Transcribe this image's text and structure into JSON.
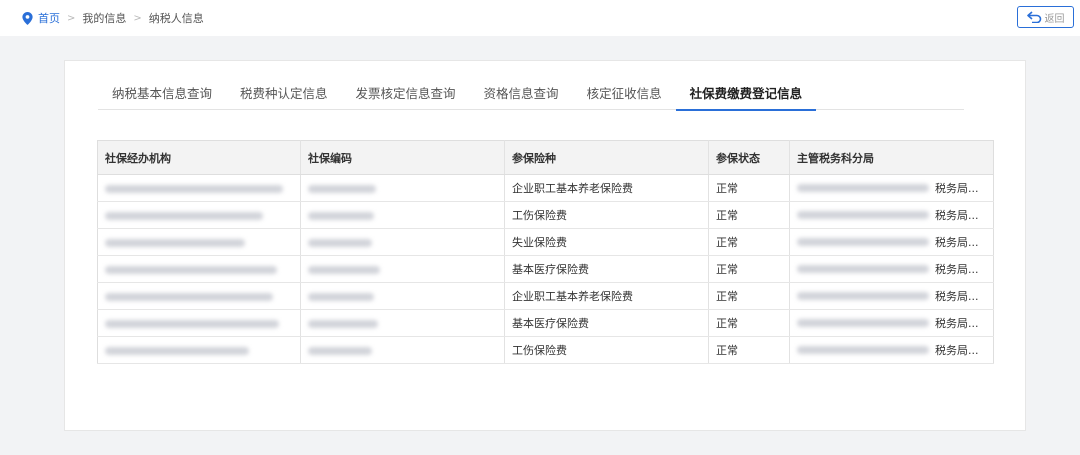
{
  "breadcrumb": {
    "home": "首页",
    "separator": ">",
    "level1": "我的信息",
    "level2": "纳税人信息"
  },
  "back_button": {
    "label": "返回",
    "icon": "back-arrow-icon"
  },
  "tabs": [
    {
      "label": "纳税基本信息查询",
      "active": false
    },
    {
      "label": "税费种认定信息",
      "active": false
    },
    {
      "label": "发票核定信息查询",
      "active": false
    },
    {
      "label": "资格信息查询",
      "active": false
    },
    {
      "label": "核定征收信息",
      "active": false
    },
    {
      "label": "社保费缴费登记信息",
      "active": true
    }
  ],
  "table": {
    "headers": [
      "社保经办机构",
      "社保编码",
      "参保险种",
      "参保状态",
      "主管税务科分局"
    ],
    "rows": [
      {
        "insurance_type": "企业职工基本养老保险费",
        "status": "正常",
        "office_suffix": "税务局..."
      },
      {
        "insurance_type": "工伤保险费",
        "status": "正常",
        "office_suffix": "税务局..."
      },
      {
        "insurance_type": "失业保险费",
        "status": "正常",
        "office_suffix": "税务局..."
      },
      {
        "insurance_type": "基本医疗保险费",
        "status": "正常",
        "office_suffix": "税务局..."
      },
      {
        "insurance_type": "企业职工基本养老保险费",
        "status": "正常",
        "office_suffix": "税务局..."
      },
      {
        "insurance_type": "基本医疗保险费",
        "status": "正常",
        "office_suffix": "税务局..."
      },
      {
        "insurance_type": "工伤保险费",
        "status": "正常",
        "office_suffix": "税务局..."
      }
    ]
  },
  "colors": {
    "accent": "#2a6fd8",
    "background": "#f2f3f5",
    "redacted": "#d2d4da"
  }
}
